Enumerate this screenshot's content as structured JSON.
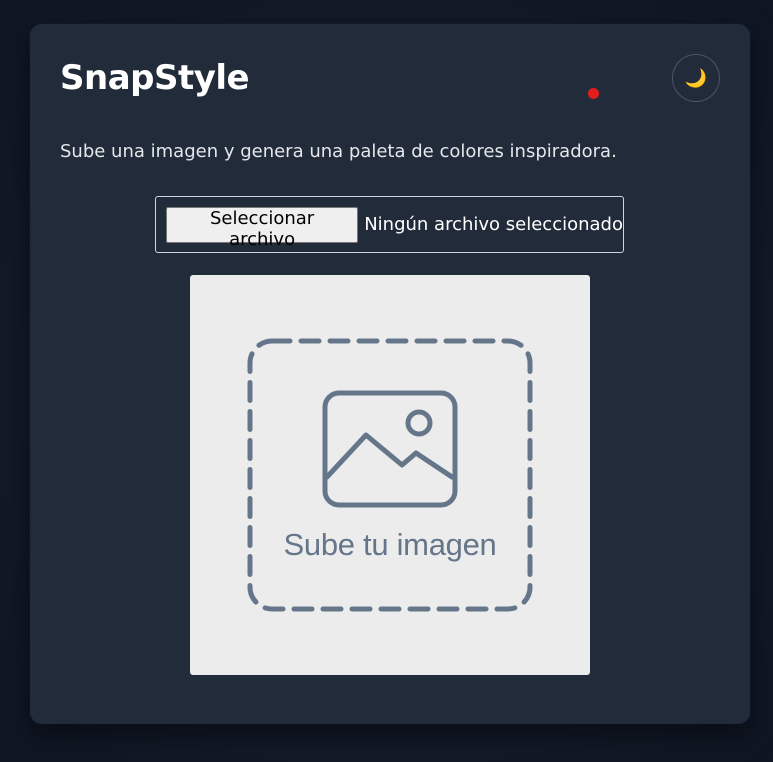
{
  "app": {
    "title": "SnapStyle",
    "subtitle": "Sube una imagen y genera una paleta de colores inspiradora."
  },
  "theme_toggle": {
    "icon": "moon-icon",
    "glyph": "🌙"
  },
  "file_input": {
    "button_label": "Seleccionar archivo",
    "status": "Ningún archivo seleccionado"
  },
  "preview": {
    "placeholder_text": "Sube tu imagen",
    "icon": "image-icon"
  },
  "colors": {
    "background": "#111827",
    "card": "#212b3a",
    "placeholder_bg": "#ececec",
    "placeholder_fg": "#66768a",
    "indicator": "#e11d1d"
  }
}
